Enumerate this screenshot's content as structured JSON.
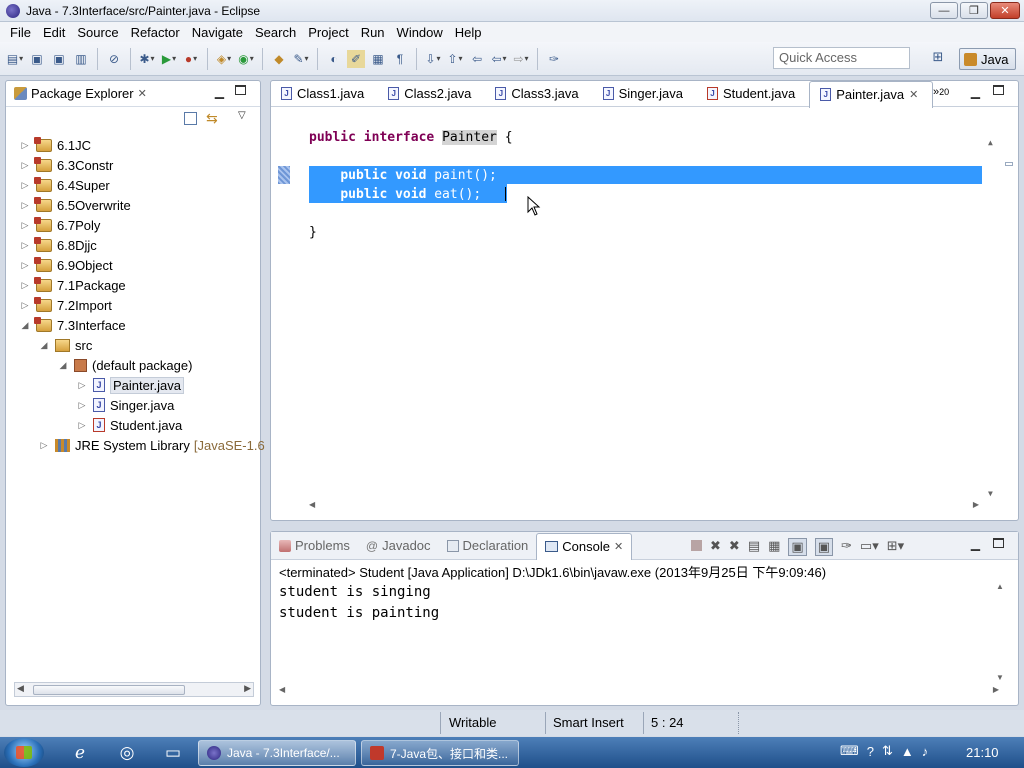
{
  "window": {
    "title": "Java - 7.3Interface/src/Painter.java - Eclipse",
    "min_glyph": "—",
    "max_glyph": "❐",
    "close_glyph": "✕"
  },
  "menu": {
    "items": [
      "File",
      "Edit",
      "Source",
      "Refactor",
      "Navigate",
      "Search",
      "Project",
      "Run",
      "Window",
      "Help"
    ]
  },
  "toolbar": {
    "quick_access_placeholder": "Quick Access",
    "perspective": "Java"
  },
  "package_explorer": {
    "title": "Package Explorer",
    "tree": [
      {
        "label": "6.1JC",
        "level": 0,
        "twisty": "▷",
        "icon": "project"
      },
      {
        "label": "6.3Constr",
        "level": 0,
        "twisty": "▷",
        "icon": "project"
      },
      {
        "label": "6.4Super",
        "level": 0,
        "twisty": "▷",
        "icon": "project"
      },
      {
        "label": "6.5Overwrite",
        "level": 0,
        "twisty": "▷",
        "icon": "project"
      },
      {
        "label": "6.7Poly",
        "level": 0,
        "twisty": "▷",
        "icon": "project"
      },
      {
        "label": "6.8Djjc",
        "level": 0,
        "twisty": "▷",
        "icon": "project"
      },
      {
        "label": "6.9Object",
        "level": 0,
        "twisty": "▷",
        "icon": "project"
      },
      {
        "label": "7.1Package",
        "level": 0,
        "twisty": "▷",
        "icon": "project"
      },
      {
        "label": "7.2Import",
        "level": 0,
        "twisty": "▷",
        "icon": "project"
      },
      {
        "label": "7.3Interface",
        "level": 0,
        "twisty": "◢",
        "icon": "project"
      },
      {
        "label": "src",
        "level": 1,
        "twisty": "◢",
        "icon": "src"
      },
      {
        "label": "(default package)",
        "level": 2,
        "twisty": "◢",
        "icon": "package"
      },
      {
        "label": "Painter.java",
        "level": 3,
        "twisty": "▷",
        "icon": "java",
        "selected": true
      },
      {
        "label": "Singer.java",
        "level": 3,
        "twisty": "▷",
        "icon": "java"
      },
      {
        "label": "Student.java",
        "level": 3,
        "twisty": "▷",
        "icon": "java-error"
      },
      {
        "label": "JRE System Library",
        "extra": "[JavaSE-1.6",
        "level": 1,
        "twisty": "▷",
        "icon": "library"
      }
    ]
  },
  "editor": {
    "tabs": [
      {
        "label": "Class1.java",
        "icon": "java"
      },
      {
        "label": "Class2.java",
        "icon": "java"
      },
      {
        "label": "Class3.java",
        "icon": "java"
      },
      {
        "label": "Singer.java",
        "icon": "java"
      },
      {
        "label": "Student.java",
        "icon": "java-error"
      },
      {
        "label": "Painter.java",
        "icon": "java",
        "active": true
      }
    ],
    "more_tabs": "»",
    "more_count": "20",
    "code": {
      "kw_public": "public",
      "kw_interface": "interface",
      "class_name": "Painter",
      "open_brace": "{",
      "line2_kw": "public void",
      "line2_rest": "paint();",
      "line3_kw": "public void",
      "line3_rest": "eat();",
      "close_brace": "}"
    }
  },
  "console": {
    "tabs": [
      "Problems",
      "Javadoc",
      "Declaration",
      "Console"
    ],
    "terminated_line": "<terminated> Student [Java Application] D:\\JDk1.6\\bin\\javaw.exe (2013年9月25日 下午9:09:46)",
    "output": [
      "student is singing",
      "student is painting"
    ]
  },
  "status": {
    "writable": "Writable",
    "insert_mode": "Smart Insert",
    "position": "5 : 24"
  },
  "taskbar": {
    "items": [
      {
        "label": "Java - 7.3Interface/...",
        "active": true
      },
      {
        "label": "7-Java包、接口和类...",
        "active": false
      }
    ],
    "clock": "21:10"
  }
}
